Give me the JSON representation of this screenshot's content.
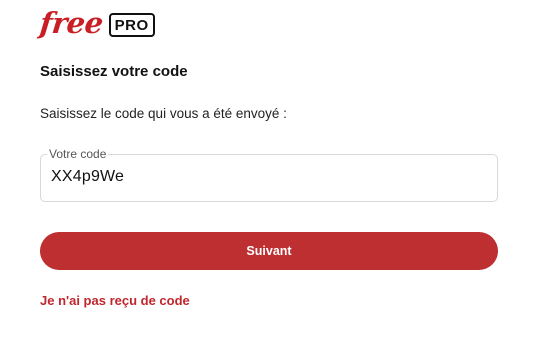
{
  "logo": {
    "brand": "free",
    "badge": "PRO",
    "brand_color": "#c81e24"
  },
  "page": {
    "title": "Saisissez votre code",
    "instruction": "Saisissez le code qui vous a été envoyé :"
  },
  "code_field": {
    "label": "Votre code",
    "value": "XX4p9We"
  },
  "actions": {
    "next_label": "Suivant",
    "next_color": "#bd2f31",
    "resend_label": "Je n'ai pas reçu de code",
    "resend_color": "#c0272d"
  }
}
